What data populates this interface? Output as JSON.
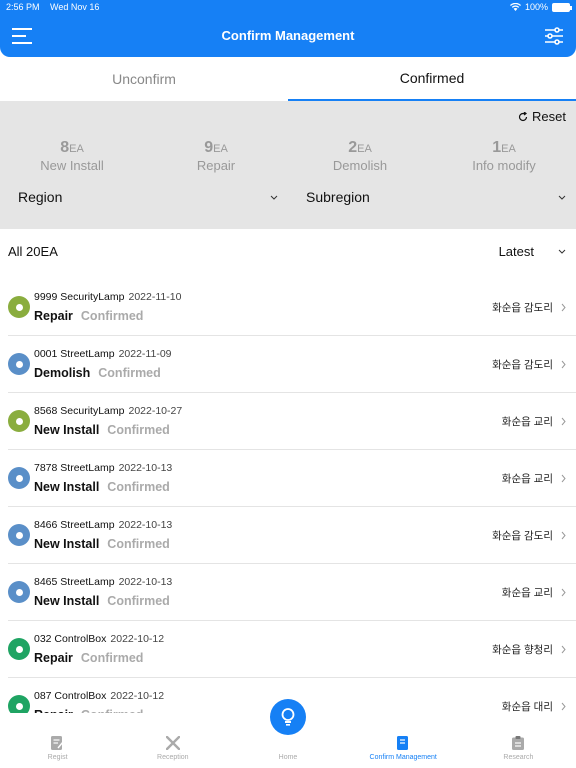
{
  "status": {
    "time": "2:56 PM",
    "date": "Wed Nov 16",
    "battery": "100%"
  },
  "header": {
    "title": "Confirm Management"
  },
  "tabs": [
    {
      "label": "Unconfirm"
    },
    {
      "label": "Confirmed"
    }
  ],
  "filters": {
    "reset_label": "Reset",
    "stats": [
      {
        "count": "8",
        "unit": "EA",
        "label": "New Install"
      },
      {
        "count": "9",
        "unit": "EA",
        "label": "Repair"
      },
      {
        "count": "2",
        "unit": "EA",
        "label": "Demolish"
      },
      {
        "count": "1",
        "unit": "EA",
        "label": "Info modify"
      }
    ],
    "region_label": "Region",
    "subregion_label": "Subregion"
  },
  "list_header": {
    "total": "All 20EA",
    "sort": "Latest"
  },
  "items": [
    {
      "name": "9999 SecurityLamp",
      "date": "2022-11-10",
      "type": "Repair",
      "state": "Confirmed",
      "region": "화순읍 감도리",
      "color": "#8aad3e"
    },
    {
      "name": "0001 StreetLamp",
      "date": "2022-11-09",
      "type": "Demolish",
      "state": "Confirmed",
      "region": "화순읍 감도리",
      "color": "#5a8fc8"
    },
    {
      "name": "8568 SecurityLamp",
      "date": "2022-10-27",
      "type": "New Install",
      "state": "Confirmed",
      "region": "화순읍 교리",
      "color": "#8aad3e"
    },
    {
      "name": "7878 StreetLamp",
      "date": "2022-10-13",
      "type": "New Install",
      "state": "Confirmed",
      "region": "화순읍 교리",
      "color": "#5a8fc8"
    },
    {
      "name": "8466 StreetLamp",
      "date": "2022-10-13",
      "type": "New Install",
      "state": "Confirmed",
      "region": "화순읍 감도리",
      "color": "#5a8fc8"
    },
    {
      "name": "8465 StreetLamp",
      "date": "2022-10-13",
      "type": "New Install",
      "state": "Confirmed",
      "region": "화순읍 교리",
      "color": "#5a8fc8"
    },
    {
      "name": "032 ControlBox",
      "date": "2022-10-12",
      "type": "Repair",
      "state": "Confirmed",
      "region": "화순읍 향청리",
      "color": "#1fa463"
    },
    {
      "name": "087 ControlBox",
      "date": "2022-10-12",
      "type": "Repair",
      "state": "Confirmed",
      "region": "화순읍 대리",
      "color": "#1fa463"
    }
  ],
  "bottom_tabs": [
    {
      "label": "Regist",
      "icon": "regist-icon"
    },
    {
      "label": "Reception",
      "icon": "tools-icon"
    },
    {
      "label": "Home",
      "icon": "lightbulb-icon"
    },
    {
      "label": "Confirm Management",
      "icon": "book-icon"
    },
    {
      "label": "Research",
      "icon": "clipboard-icon"
    }
  ],
  "colors": {
    "accent": "#1680f5",
    "panel": "#e5e5e5"
  }
}
